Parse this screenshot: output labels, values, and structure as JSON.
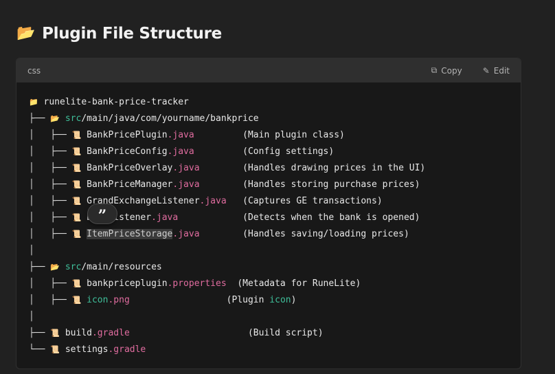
{
  "heading": {
    "icon": "📂",
    "title": "Plugin File Structure"
  },
  "codeblock": {
    "language": "css",
    "copy_label": "Copy",
    "edit_label": "Edit"
  },
  "tree": [
    {
      "prefix": "",
      "icon": "📁",
      "name": "runelite-bank-price-tracker",
      "ext": "",
      "dir": "",
      "pad": "",
      "comment": ""
    },
    {
      "prefix": "├── ",
      "icon": "📂",
      "dir": "src",
      "name": "/main/java/com/yourname/bankprice",
      "ext": "",
      "pad": "",
      "comment": ""
    },
    {
      "prefix": "│   ├── ",
      "icon": "📜",
      "name": "BankPricePlugin",
      "ext": ".java",
      "pad": "         ",
      "comment": "(Main plugin class)"
    },
    {
      "prefix": "│   ├── ",
      "icon": "📜",
      "name": "BankPriceConfig",
      "ext": ".java",
      "pad": "         ",
      "comment": "(Config settings)"
    },
    {
      "prefix": "│   ├── ",
      "icon": "📜",
      "name": "BankPriceOverlay",
      "ext": ".java",
      "pad": "        ",
      "comment": "(Handles drawing prices in the UI)"
    },
    {
      "prefix": "│   ├── ",
      "icon": "📜",
      "name": "BankPriceManager",
      "ext": ".java",
      "pad": "        ",
      "comment": "(Handles storing purchase prices)"
    },
    {
      "prefix": "│   ├── ",
      "icon": "📜",
      "name": "GrandExchangeListener",
      "ext": ".java",
      "pad": "   ",
      "comment": "(Captures GE transactions)"
    },
    {
      "prefix": "│   ├── ",
      "icon": "📜",
      "name": "BankListener",
      "ext": ".java",
      "pad": "            ",
      "comment": "(Detects when the bank is opened)"
    },
    {
      "prefix": "│   ├── ",
      "icon": "📜",
      "name": "ItemPriceStorage",
      "ext": ".java",
      "pad": "        ",
      "comment": "(Handles saving/loading prices)"
    },
    {
      "prefix": "│",
      "icon": "",
      "name": "",
      "ext": "",
      "pad": "",
      "comment": ""
    },
    {
      "prefix": "├── ",
      "icon": "📂",
      "dir": "src",
      "name": "/main/resources",
      "ext": "",
      "pad": "",
      "comment": ""
    },
    {
      "prefix": "│   ├── ",
      "icon": "📜",
      "name": "bankpriceplugin",
      "ext": ".properties",
      "pad": "  ",
      "comment": "(Metadata for RuneLite)"
    },
    {
      "prefix": "│   ├── ",
      "icon": "📜",
      "dir": "icon",
      "name": "",
      "ext": ".png",
      "pad": "                  ",
      "comment": "(Plugin ",
      "comment_dir": "icon",
      "comment_end": ")"
    },
    {
      "prefix": "│",
      "icon": "",
      "name": "",
      "ext": "",
      "pad": "",
      "comment": ""
    },
    {
      "prefix": "├── ",
      "icon": "📜",
      "name": "build",
      "ext": ".gradle",
      "pad": "                      ",
      "comment": "(Build script)"
    },
    {
      "prefix": "└── ",
      "icon": "📜",
      "name": "settings",
      "ext": ".gradle",
      "pad": "",
      "comment": ""
    }
  ],
  "tooltip": {
    "glyph": "”"
  }
}
